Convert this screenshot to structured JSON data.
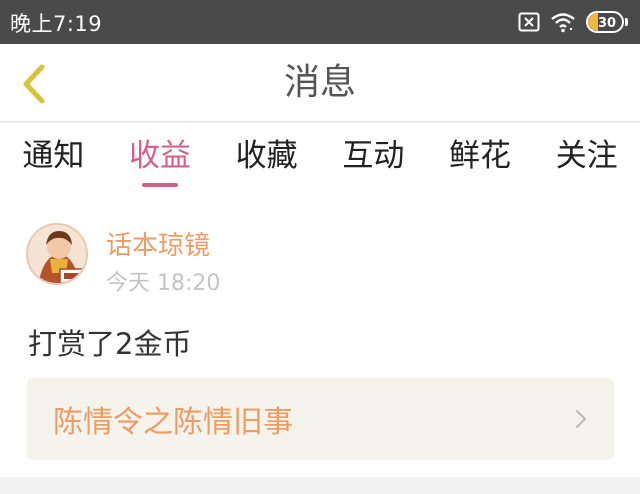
{
  "status_bar": {
    "time": "晚上7:19",
    "battery_level": "30",
    "battery_fraction": 0.3,
    "icons": [
      "sim-card-icon",
      "wifi-icon",
      "battery-icon"
    ]
  },
  "nav": {
    "title": "消息",
    "back_icon": "chevron-left-icon"
  },
  "tabs": [
    {
      "label": "通知",
      "active": false
    },
    {
      "label": "收益",
      "active": true
    },
    {
      "label": "收藏",
      "active": false
    },
    {
      "label": "互动",
      "active": false
    },
    {
      "label": "鲜花",
      "active": false
    },
    {
      "label": "关注",
      "active": false
    }
  ],
  "message": {
    "sender": "话本琼镜",
    "time": "今天 18:20",
    "text": "打赏了2金币",
    "book_title": "陈情令之陈情旧事",
    "book_icon": "chevron-right-icon"
  },
  "colors": {
    "status_bar": "#4a4a4a",
    "accent": "#d75f8a",
    "back_arrow": "#d6c43a",
    "sender": "#ef9c64",
    "book_title": "#ef9c64",
    "battery": "#f0b642"
  }
}
